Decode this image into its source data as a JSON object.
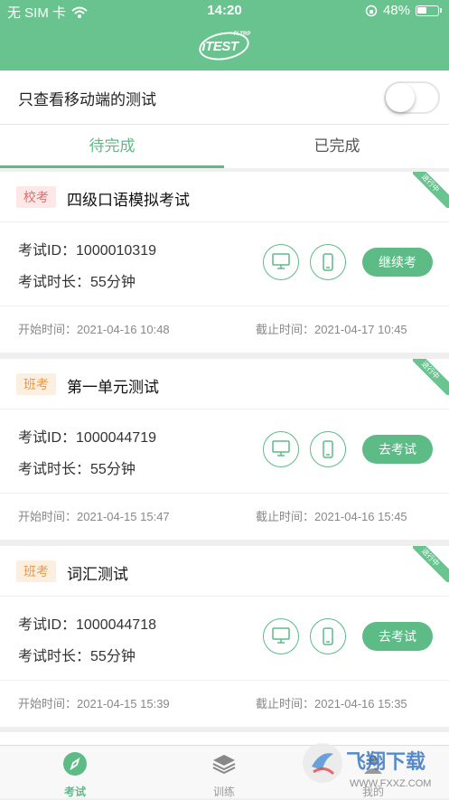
{
  "status_bar": {
    "carrier": "无 SIM 卡",
    "time": "14:20",
    "battery": "48%"
  },
  "logo": {
    "text": "iTEST",
    "small": "FLTRP"
  },
  "filter": {
    "label": "只查看移动端的测试",
    "enabled": false
  },
  "tabs": [
    {
      "label": "待完成",
      "active": true
    },
    {
      "label": "已完成",
      "active": false
    }
  ],
  "corner_label": "进行中",
  "id_label": "考试ID：",
  "duration_label": "考试时长：",
  "start_label": "开始时间：",
  "end_label": "截止时间：",
  "exams": [
    {
      "tag": "校考",
      "title": "四级口语模拟考试",
      "id": "1000010319",
      "duration": "55分钟",
      "action": "继续考试",
      "start": "2021-04-16 10:48",
      "end": "2021-04-17 10:45"
    },
    {
      "tag": "班考",
      "title": "第一单元测试",
      "id": "1000044719",
      "duration": "55分钟",
      "action": "去考试",
      "start": "2021-04-15 15:47",
      "end": "2021-04-16 15:45"
    },
    {
      "tag": "班考",
      "title": "词汇测试",
      "id": "1000044718",
      "duration": "55分钟",
      "action": "去考试",
      "start": "2021-04-15 15:39",
      "end": "2021-04-16 15:35"
    }
  ],
  "tabbar": [
    {
      "label": "考试",
      "icon": "compass-icon",
      "active": true
    },
    {
      "label": "训练",
      "icon": "layers-icon",
      "active": false
    },
    {
      "label": "我的",
      "icon": "person-icon",
      "active": false
    }
  ],
  "watermark": {
    "text": "飞翔下载",
    "url": "WWW.FXXZ.COM"
  },
  "colors": {
    "primary": "#5dbb86",
    "header": "#68c38e",
    "school_tag": "#e56c6c",
    "class_tag": "#ed9a4b"
  }
}
